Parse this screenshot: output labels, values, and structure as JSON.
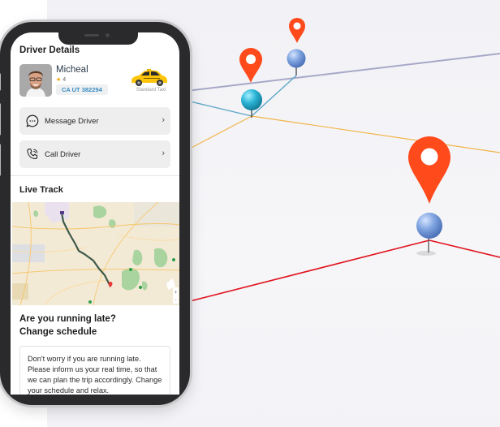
{
  "driver_details": {
    "title": "Driver Details",
    "driver_name": "Micheal",
    "rating": "4",
    "license_plate": "CA UT 382294",
    "vehicle_type": "Standard Taxi"
  },
  "actions": [
    {
      "label": "Message Driver",
      "icon": "chat-bubble-icon"
    },
    {
      "label": "Call Driver",
      "icon": "phone-icon"
    }
  ],
  "live_track": {
    "title": "Live Track"
  },
  "schedule": {
    "title_line1": "Are you running late?",
    "title_line2": "Change schedule",
    "body": "Don't worry if you are running late. Please inform us your real time, so that we can plan the trip accordingly. Change your schedule and relax."
  },
  "colors": {
    "pin_red": "#ff4a1c",
    "plate_text": "#3a8ec2",
    "star": "#f3a400",
    "route": "#3f5a4a"
  }
}
